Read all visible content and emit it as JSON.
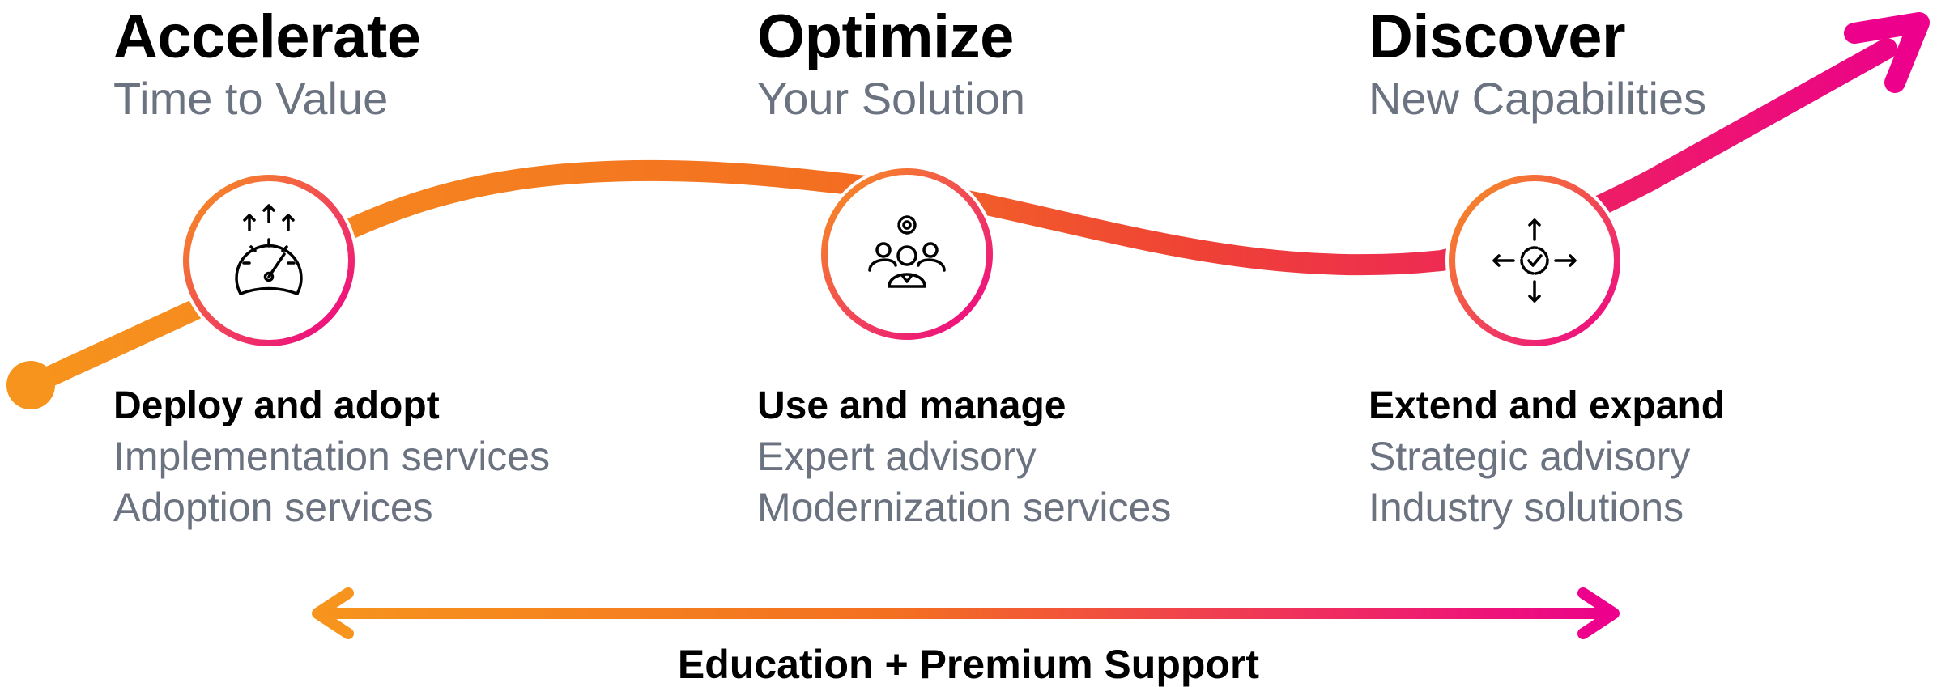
{
  "stages": [
    {
      "title": "Accelerate",
      "subtitle": "Time to Value",
      "icon": "speedometer-icon"
    },
    {
      "title": "Optimize",
      "subtitle": "Your Solution",
      "icon": "team-gear-icon"
    },
    {
      "title": "Discover",
      "subtitle": "New Capabilities",
      "icon": "gear-arrows-icon"
    }
  ],
  "services": [
    {
      "heading": "Deploy and adopt",
      "items": [
        "Implementation services",
        "Adoption services"
      ]
    },
    {
      "heading": "Use and manage",
      "items": [
        "Expert advisory",
        "Modernization services"
      ]
    },
    {
      "heading": "Extend and expand",
      "items": [
        "Strategic advisory",
        "Industry solutions"
      ]
    }
  ],
  "footer": {
    "label": "Education + Premium Support"
  },
  "colors": {
    "orange": "#f7941d",
    "deep_orange": "#f36f21",
    "red": "#ef4136",
    "magenta": "#ec008c",
    "title_text": "#000000",
    "subtitle_text": "#6b7280"
  }
}
